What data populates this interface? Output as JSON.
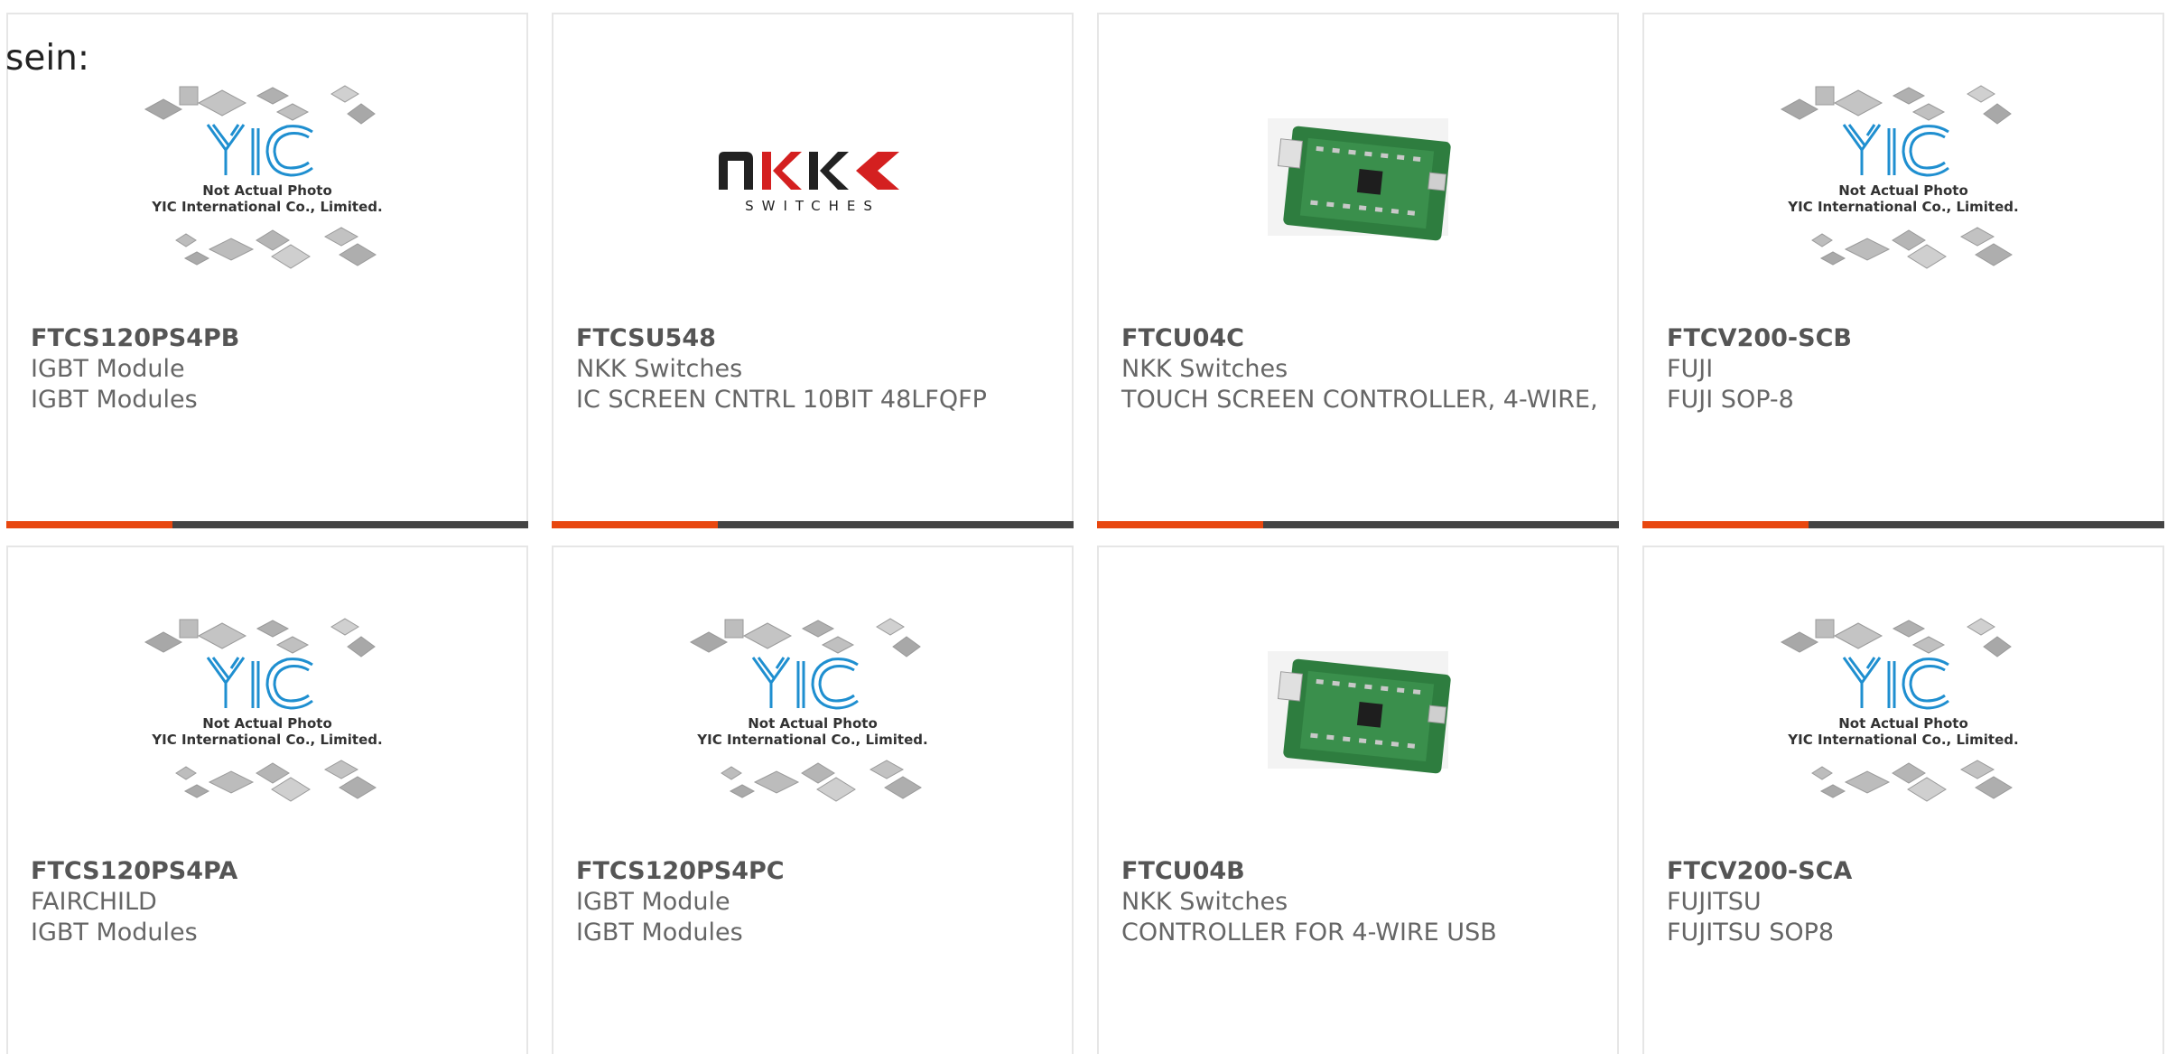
{
  "intro_text": "sein:",
  "placeholder_caption": {
    "line1": "Not Actual Photo",
    "line2": "YIC International Co., Limited."
  },
  "nkk_logo": {
    "word": "NKK",
    "sub": "SWITCHES"
  },
  "colors": {
    "accent": "#e8470f",
    "bar": "#444444",
    "text": "#666666",
    "logo_blue": "#1f8fd0"
  },
  "products": [
    {
      "part": "FTCS120PS4PB",
      "maker": "IGBT Module",
      "desc": "IGBT Modules",
      "image": "yic-placeholder-icon"
    },
    {
      "part": "FTCSU548",
      "maker": "NKK Switches",
      "desc": "IC SCREEN CNTRL 10BIT 48LFQFP",
      "image": "nkk-logo-icon"
    },
    {
      "part": "FTCU04C",
      "maker": "NKK Switches",
      "desc": "TOUCH SCREEN CONTROLLER, 4-WIRE,",
      "image": "pcb-board-icon"
    },
    {
      "part": "FTCV200-SCB",
      "maker": "FUJI",
      "desc": "FUJI SOP-8",
      "image": "yic-placeholder-icon"
    },
    {
      "part": "FTCS120PS4PA",
      "maker": "FAIRCHILD",
      "desc": "IGBT Modules",
      "image": "yic-placeholder-icon"
    },
    {
      "part": "FTCS120PS4PC",
      "maker": "IGBT Module",
      "desc": "IGBT Modules",
      "image": "yic-placeholder-icon"
    },
    {
      "part": "FTCU04B",
      "maker": "NKK Switches",
      "desc": "CONTROLLER FOR 4-WIRE USB",
      "image": "pcb-board-icon"
    },
    {
      "part": "FTCV200-SCA",
      "maker": "FUJITSU",
      "desc": "FUJITSU SOP8",
      "image": "yic-placeholder-icon"
    }
  ]
}
